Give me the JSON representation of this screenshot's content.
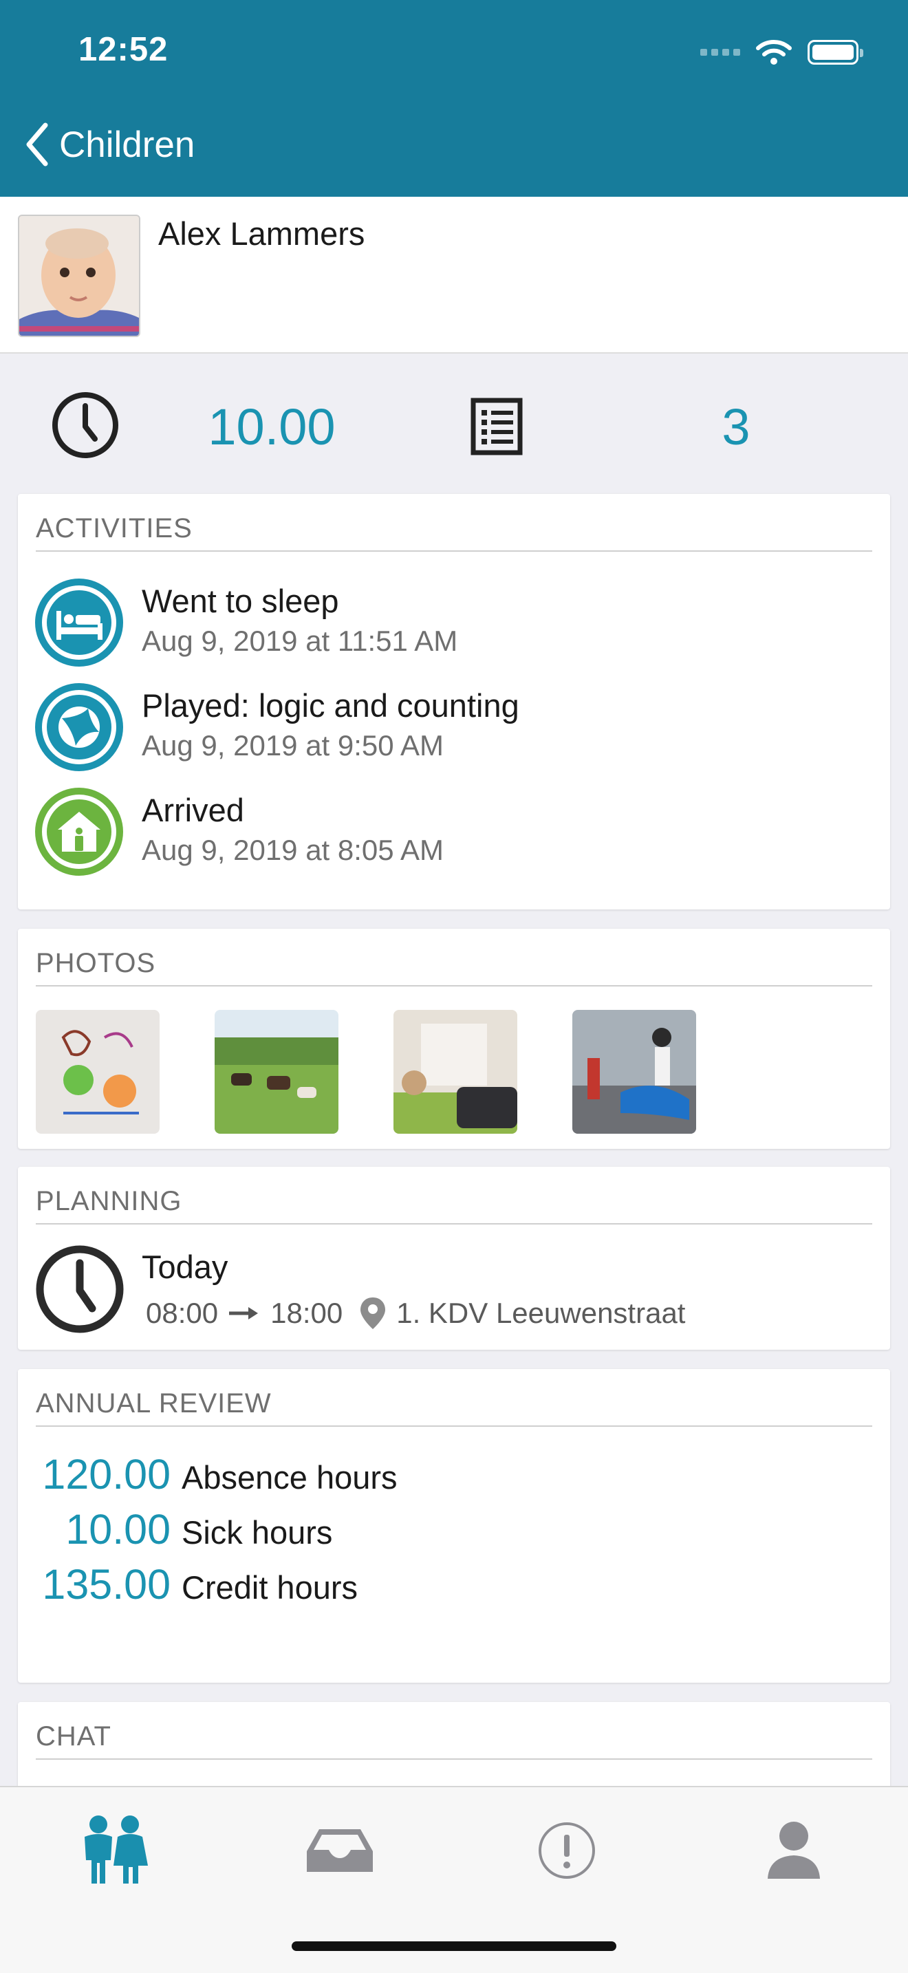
{
  "status_bar": {
    "time": "12:52"
  },
  "nav": {
    "back_label": "Children"
  },
  "child": {
    "name": "Alex Lammers"
  },
  "summary": {
    "hours": "10.00",
    "count": "3"
  },
  "activities": {
    "title": "ACTIVITIES",
    "items": [
      {
        "title": "Went to sleep",
        "time": "Aug 9, 2019 at 11:51 AM",
        "icon": "bed-icon"
      },
      {
        "title": "Played: logic and counting",
        "time": "Aug 9, 2019 at 9:50 AM",
        "icon": "ball-icon"
      },
      {
        "title": "Arrived",
        "time": "Aug 9, 2019 at 8:05 AM",
        "icon": "house-person-icon"
      }
    ]
  },
  "photos": {
    "title": "PHOTOS"
  },
  "planning": {
    "title": "PLANNING",
    "day": "Today",
    "start": "08:00",
    "end": "18:00",
    "location": "1. KDV Leeuwenstraat"
  },
  "annual_review": {
    "title": "ANNUAL REVIEW",
    "rows": [
      {
        "value": "120.00",
        "label": "Absence hours"
      },
      {
        "value": "10.00",
        "label": "Sick hours"
      },
      {
        "value": "135.00",
        "label": "Credit hours"
      }
    ]
  },
  "chat": {
    "title": "CHAT"
  },
  "tabbar": {
    "items": [
      "children-icon",
      "inbox-icon",
      "alert-icon",
      "profile-icon"
    ]
  },
  "colors": {
    "brand": "#177c9b",
    "accent": "#1a93b1",
    "green": "#6cb43f"
  }
}
